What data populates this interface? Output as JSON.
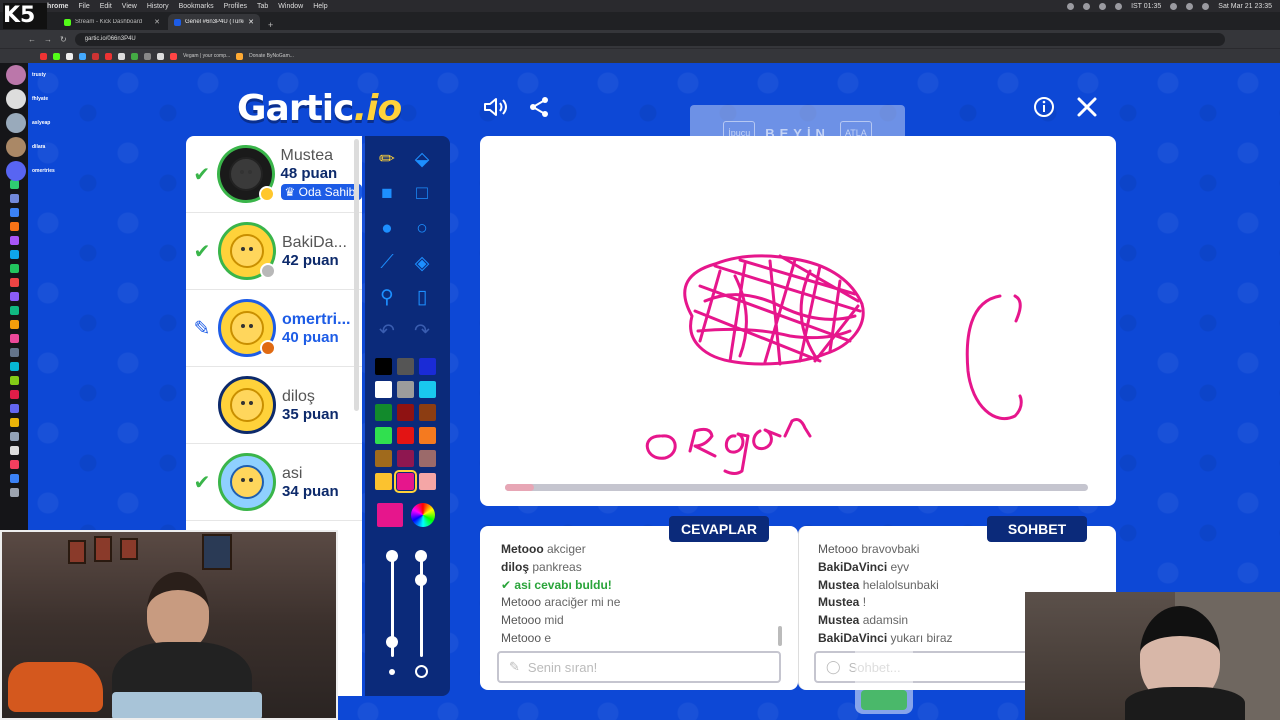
{
  "menubar": {
    "items": [
      "Chrome",
      "File",
      "Edit",
      "View",
      "History",
      "Bookmarks",
      "Profiles",
      "Tab",
      "Window",
      "Help"
    ],
    "status_text": "IST 01:35",
    "datetime": "Sat Mar 21 23:35"
  },
  "browser": {
    "tabs": [
      {
        "label": "Stream - Kick Dashboard",
        "active": false
      },
      {
        "label": "Genel #6n3P4U (Türkçe) - G",
        "active": true
      }
    ],
    "url": "gartic.io/066n3P4U",
    "bookmarks": [
      "Vegam | your comp...",
      "Donate ByNoGam..."
    ]
  },
  "stream_overlay": {
    "logo": "K5",
    "viewers": [
      "trusty",
      "fhlyate",
      "aslyeap",
      "dilara",
      "omertries"
    ]
  },
  "game": {
    "logo_main": "Gartic",
    "logo_suffix": ".io",
    "word_hint": {
      "left_button": "İpucu",
      "word": "BEYİN",
      "right_button": "ATLA"
    },
    "players": [
      {
        "name": "Mustea",
        "score": "48 puan",
        "badge": "Oda Sahibi",
        "status": "guessed"
      },
      {
        "name": "BakiDa...",
        "score": "42 puan",
        "status": "guessed"
      },
      {
        "name": "omertri...",
        "score": "40 puan",
        "status": "drawing"
      },
      {
        "name": "diloş",
        "score": "35 puan",
        "status": "none"
      },
      {
        "name": "asi",
        "score": "34 puan",
        "status": "guessed"
      }
    ],
    "colors": {
      "selected": "#e6168c",
      "palette": [
        "#000000",
        "#555555",
        "#1a2bd6",
        "#ffffff",
        "#9c9c9c",
        "#19c8ef",
        "#128a2c",
        "#8f1212",
        "#8c3d12",
        "#30e04f",
        "#e31414",
        "#f57a1f",
        "#a06a1c",
        "#8e1750",
        "#9b6a6a",
        "#fbc22f",
        "#e6168c",
        "#f5a6a6"
      ]
    },
    "round_progress": 0.05,
    "answers": {
      "title": "CEVAPLAR",
      "messages": [
        {
          "user": "Metooo",
          "text": "akciger"
        },
        {
          "user": "diloş",
          "text": "pankreas"
        },
        {
          "user": "asi",
          "text": "cevabı buldu!",
          "correct": true
        },
        {
          "user": "Metooo",
          "text": "araciğer mi ne"
        },
        {
          "user": "Metooo",
          "text": "mid"
        },
        {
          "user": "Metooo",
          "text": "e"
        }
      ],
      "placeholder": "Senin sıran!"
    },
    "chat": {
      "title": "SOHBET",
      "messages": [
        {
          "user": "Metooo",
          "text": "bravovbaki"
        },
        {
          "user": "BakiDaVinci",
          "text": "eyv"
        },
        {
          "user": "Mustea",
          "text": "helalolsunbaki"
        },
        {
          "user": "Mustea",
          "text": "!"
        },
        {
          "user": "Mustea",
          "text": "adamsin"
        },
        {
          "user": "BakiDaVinci",
          "text": "yukarı biraz"
        }
      ],
      "placeholder": "Sohbet..."
    },
    "drawing_text": "ORgan"
  }
}
